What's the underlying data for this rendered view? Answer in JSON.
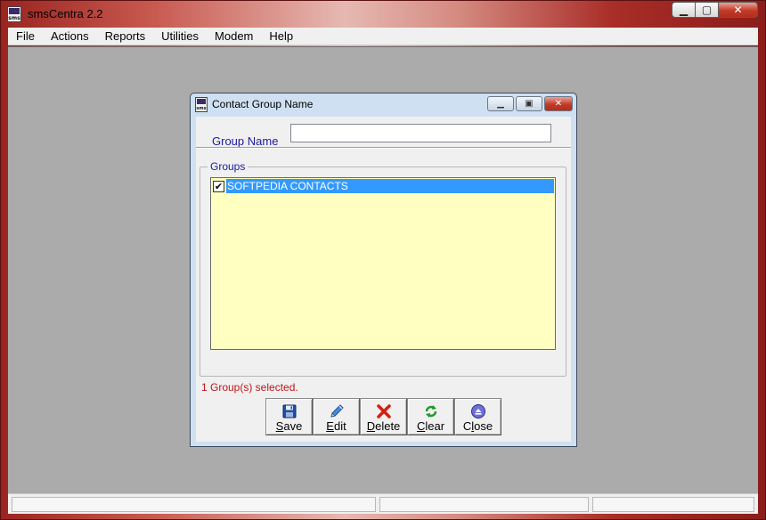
{
  "app": {
    "title": "smsCentra 2.2",
    "icon_text": "sms"
  },
  "menu": {
    "items": [
      "File",
      "Actions",
      "Reports",
      "Utilities",
      "Modem",
      "Help"
    ]
  },
  "dialog": {
    "title": "Contact Group Name",
    "icon_text": "sms",
    "group_name_label": "Group Name",
    "group_name_value": "",
    "groups_label": "Groups",
    "groups": [
      {
        "label": "SOFTPEDIA CONTACTS",
        "checked": true,
        "selected": true
      }
    ],
    "status_text": "1 Group(s) selected.",
    "buttons": [
      {
        "label": "Save",
        "icon": "floppy-disk-icon"
      },
      {
        "label": "Edit",
        "icon": "pencil-icon"
      },
      {
        "label": "Delete",
        "icon": "red-x-icon"
      },
      {
        "label": "Clear",
        "icon": "refresh-arrows-icon"
      },
      {
        "label": "Close",
        "icon": "eject-circle-icon"
      }
    ]
  },
  "colors": {
    "label_blue": "#1a1aa0",
    "status_red": "#c0141a",
    "list_bg": "#ffffc1",
    "selection": "#3399ff"
  }
}
